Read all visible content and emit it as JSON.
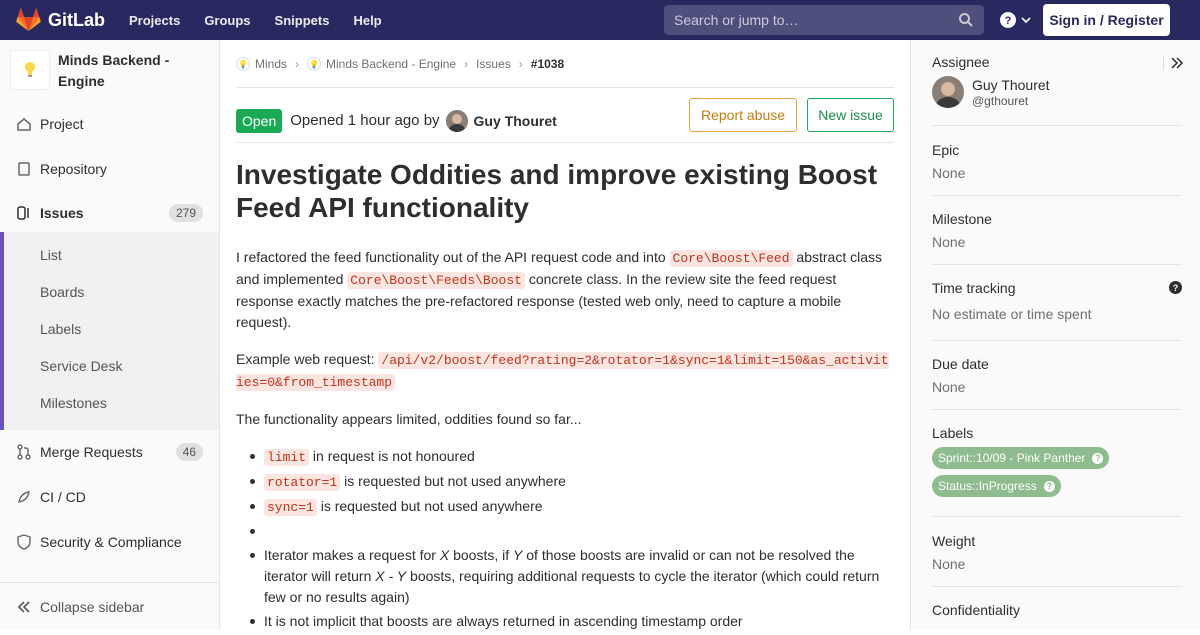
{
  "topbar": {
    "brand": "GitLab",
    "nav": [
      "Projects",
      "Groups",
      "Snippets",
      "Help"
    ],
    "search_placeholder": "Search or jump to…",
    "signin_label": "Sign in / Register"
  },
  "sidebar": {
    "project_name": "Minds Backend - Engine",
    "items": {
      "project": "Project",
      "repository": "Repository",
      "issues": "Issues",
      "issues_count": "279",
      "merge_requests": "Merge Requests",
      "mr_count": "46",
      "cicd": "CI / CD",
      "security": "Security & Compliance"
    },
    "issue_sub": [
      "List",
      "Boards",
      "Labels",
      "Service Desk",
      "Milestones"
    ],
    "collapse_label": "Collapse sidebar"
  },
  "breadcrumb": {
    "group": "Minds",
    "project": "Minds Backend - Engine",
    "issues": "Issues",
    "current": "#1038"
  },
  "issue": {
    "status": "Open",
    "opened_text": "Opened 1 hour ago by",
    "author": "Guy Thouret",
    "report_abuse": "Report abuse",
    "new_issue": "New issue",
    "title": "Investigate Oddities and improve existing Boost Feed API functionality",
    "p1_a": "I refactored the feed functionality out of the API request code and into ",
    "p1_code1": "Core\\Boost\\Feed",
    "p1_b": " abstract class and implemented ",
    "p1_code2": "Core\\Boost\\Feeds\\Boost",
    "p1_c": " concrete class. In the review site the feed request response exactly matches the pre-refactored response (tested web only, need to capture a mobile request).",
    "p2_a": "Example web request: ",
    "p2_code": "/api/v2/boost/feed?rating=2&rotator=1&sync=1&limit=150&as_activities=0&from_timestamp",
    "p3": "The functionality appears limited, oddities found so far...",
    "li1_code": "limit",
    "li1_text": " in request is not honoured",
    "li2_code": "rotator=1",
    "li2_text": " is requested but not used anywhere",
    "li3_code": "sync=1",
    "li3_text": " is requested but not used anywhere",
    "li5_a": "Iterator makes a request for ",
    "li5_x": "X",
    "li5_b": " boosts, if ",
    "li5_y": "Y",
    "li5_c": " of those boosts are invalid or can not be resolved the iterator will return ",
    "li5_xy": "X - Y",
    "li5_d": " boosts, requiring additional requests to cycle the iterator (which could return few or no results again)",
    "li6": "It is not implicit that boosts are always returned in ascending timestamp order"
  },
  "right": {
    "assignee_title": "Assignee",
    "assignee_name": "Guy Thouret",
    "assignee_handle": "@gthouret",
    "epic_title": "Epic",
    "epic_value": "None",
    "milestone_title": "Milestone",
    "milestone_value": "None",
    "time_title": "Time tracking",
    "time_value": "No estimate or time spent",
    "due_title": "Due date",
    "due_value": "None",
    "labels_title": "Labels",
    "label1": "Sprint::10/09 - Pink Panther",
    "label2": "Status::InProgress",
    "weight_title": "Weight",
    "weight_value": "None",
    "conf_title": "Confidentiality",
    "label_color": "#8fbc8f"
  }
}
